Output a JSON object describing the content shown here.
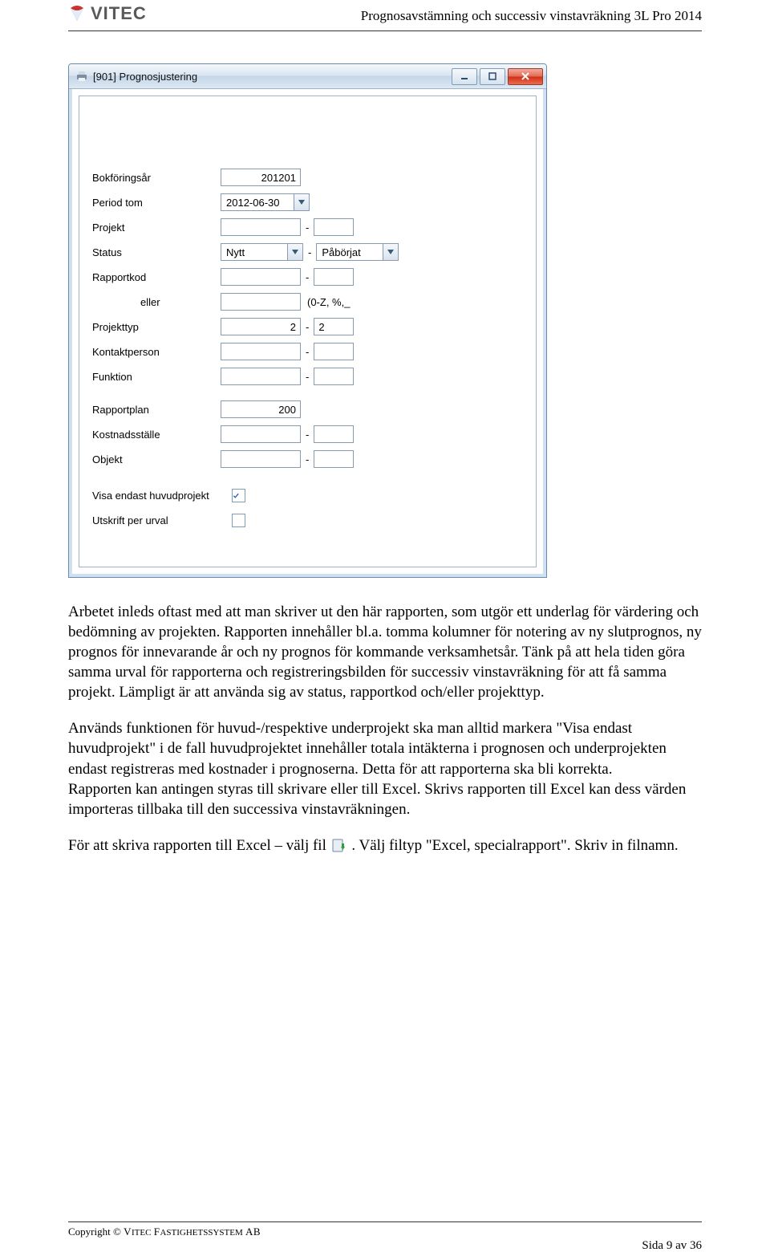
{
  "header": {
    "logo_text": "VITEC",
    "title": "Prognosavstämning och successiv vinstavräkning 3L Pro 2014"
  },
  "window": {
    "title": "[901]  Prognosjustering",
    "form": {
      "bokforingsar": {
        "label": "Bokföringsår",
        "value": "201201"
      },
      "period_tom": {
        "label": "Period tom",
        "value": "2012-06-30"
      },
      "projekt": {
        "label": "Projekt",
        "from": "",
        "to": ""
      },
      "status": {
        "label": "Status",
        "from": "Nytt",
        "to": "Påbörjat"
      },
      "rapportkod": {
        "label": "Rapportkod",
        "from": "",
        "to": ""
      },
      "eller": {
        "label": "eller",
        "value": "",
        "hint": "(0-Z, %,_"
      },
      "projekttyp": {
        "label": "Projekttyp",
        "from": "2",
        "to": "2"
      },
      "kontaktperson": {
        "label": "Kontaktperson",
        "from": "",
        "to": ""
      },
      "funktion": {
        "label": "Funktion",
        "from": "",
        "to": ""
      },
      "rapportplan": {
        "label": "Rapportplan",
        "value": "200"
      },
      "kostnadsstalle": {
        "label": "Kostnadsställe",
        "from": "",
        "to": ""
      },
      "objekt": {
        "label": "Objekt",
        "from": "",
        "to": ""
      },
      "visa_endast": {
        "label": "Visa endast huvudprojekt",
        "checked": true
      },
      "utskrift_per_urval": {
        "label": "Utskrift per urval",
        "checked": false
      }
    }
  },
  "paragraphs": {
    "p1": "Arbetet inleds oftast med att man skriver ut den här rapporten, som utgör ett underlag för värdering och bedömning av projekten. Rapporten innehåller bl.a. tomma kolumner för notering av ny slutprognos, ny prognos för innevarande år och ny prognos för kommande verksamhetsår. Tänk på att hela tiden göra samma urval för rapporterna och registreringsbilden för successiv vinstavräkning för att få samma projekt. Lämpligt är att använda sig av status, rapportkod och/eller projekttyp.",
    "p2": "Används funktionen för huvud-/respektive underprojekt ska man alltid markera \"Visa endast huvudprojekt\" i de fall huvudprojektet innehåller totala intäkterna i prognosen och underprojekten endast registreras med kostnader i prognoserna. Detta för att rapporterna ska bli korrekta.",
    "p3": "Rapporten kan antingen styras till skrivare eller till Excel. Skrivs rapporten till Excel kan dess värden importeras tillbaka till den successiva vinstavräkningen.",
    "p4a": "För att skriva rapporten till Excel – välj fil ",
    "p4b": ". Välj filtyp \"Excel, specialrapport\". Skriv in filnamn."
  },
  "footer": {
    "copyright": "Copyright © VITEC FASTIGHETSSYSTEM AB",
    "page": "Sida 9 av 36"
  }
}
